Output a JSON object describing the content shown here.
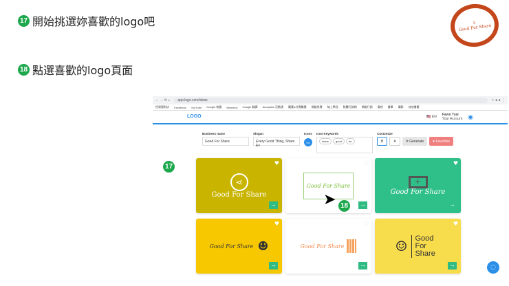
{
  "steps": [
    {
      "num": "17",
      "text": "開始挑選妳喜歡的logo吧"
    },
    {
      "num": "18",
      "text": "點選喜歡的logo頁面"
    }
  ],
  "stamp": {
    "text": "Good For Share"
  },
  "browser": {
    "url": "app.logo.com/ideas",
    "bookmarks": [
      "投資理財坊",
      "Facebook",
      "YouTube",
      "Google 地圖",
      "Mixerbox",
      "Google 翻譯",
      "Accupass 活動通",
      "醫藥&外賣醫藥",
      "網路抓寶",
      "線上學程",
      "軟體行銷網",
      "網路行銷",
      "電視",
      "書單",
      "攝影",
      "其他書籤"
    ]
  },
  "app": {
    "logo": "LOGO",
    "lang": "EN",
    "account_name": "Fawn Tsai",
    "account_sub": "Your Account",
    "form": {
      "business_label": "Business name",
      "business_value": "Good For Share",
      "slogan_label": "Slogan",
      "slogan_value": "Every Good Thing, Share Ev",
      "icons_label": "Icons",
      "icons_toggle": "On",
      "keywords_label": "Icon Keywords",
      "keywords": [
        "share",
        "good",
        "for"
      ],
      "customize_label": "Customize",
      "generate": "Generate",
      "favorites": "Favorites"
    },
    "cards": [
      {
        "name": "Good For Share"
      },
      {
        "name": "Good For Share"
      },
      {
        "name": "Good For Share"
      },
      {
        "name": "Good For Share"
      },
      {
        "name": "Good For Share"
      },
      {
        "name": "Good For Share"
      }
    ]
  },
  "markers": {
    "m17": "17",
    "m18": "18"
  }
}
